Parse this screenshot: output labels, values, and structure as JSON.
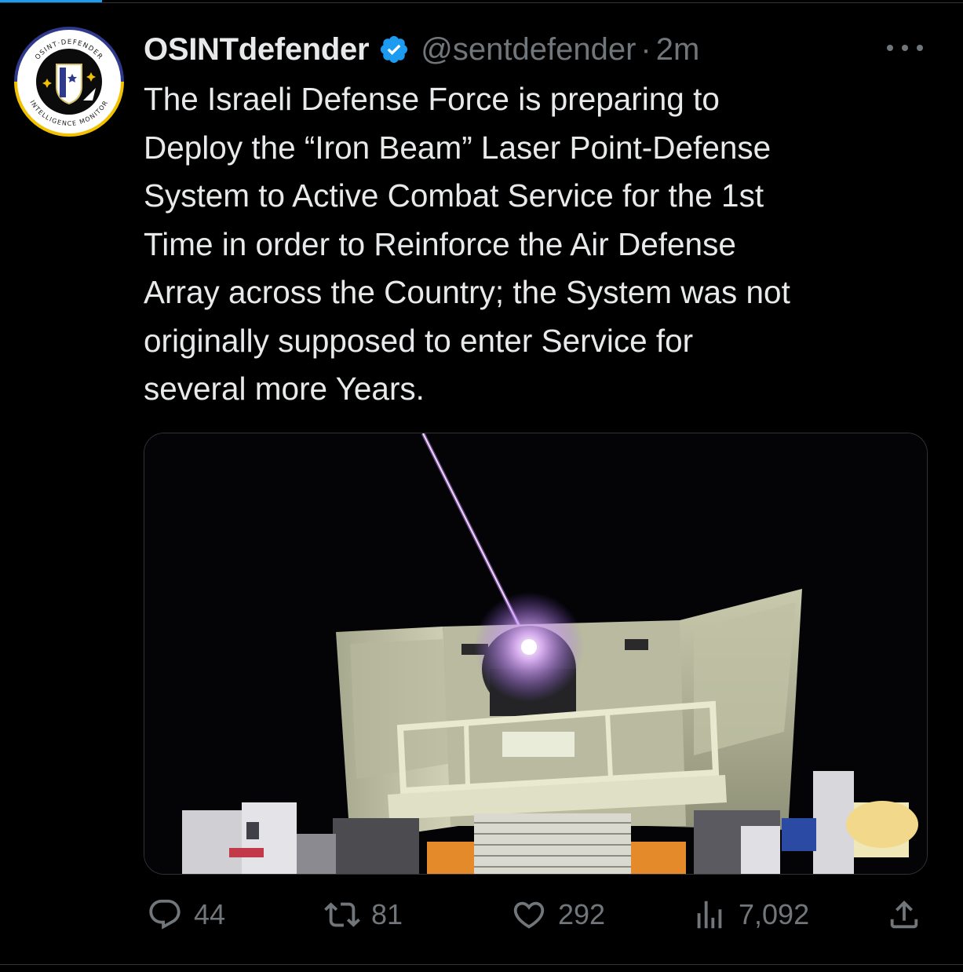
{
  "tweet": {
    "display_name": "OSINTdefender",
    "handle": "@sentdefender",
    "separator": "·",
    "time": "2m",
    "text_lines": [
      "The Israeli Defense Force is preparing to",
      "Deploy the “Iron Beam” Laser Point-Defense",
      "System to Active Combat Service for the 1st",
      "Time in order to Reinforce the Air Defense",
      "Array across the Country; the System was not",
      "originally supposed to enter Service for",
      "several more Years."
    ],
    "avatar_ring_top": "OSINT·DEFENDER",
    "avatar_ring_bottom": "INTELLIGENCE MONITOR"
  },
  "icons": {
    "verified": "verified-badge-icon",
    "more": "more-options-icon",
    "reply": "reply-icon",
    "retweet": "retweet-icon",
    "like": "heart-icon",
    "views": "views-icon",
    "share": "share-icon"
  },
  "metrics": {
    "replies": "44",
    "retweets": "81",
    "likes": "292",
    "views": "7,092"
  },
  "colors": {
    "background": "#000000",
    "text": "#e7e9ea",
    "muted": "#71767b",
    "verified": "#1d9bf0",
    "laser": "#d9a8ff"
  }
}
